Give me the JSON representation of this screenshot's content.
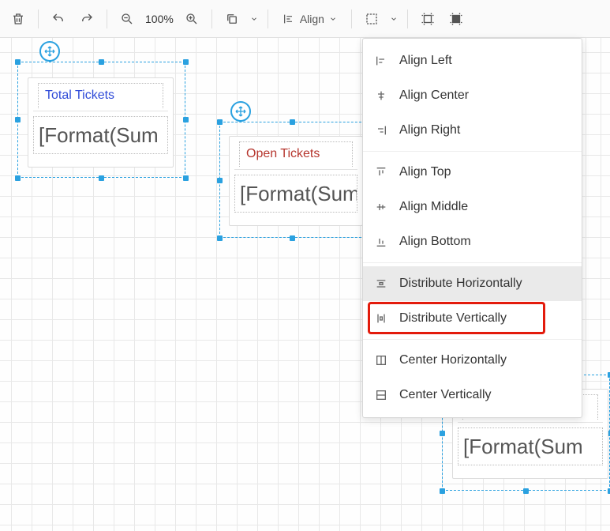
{
  "toolbar": {
    "zoom_label": "100%",
    "align_label": "Align"
  },
  "cards": {
    "c1": {
      "title": "Total Tickets",
      "body": "[Format(Sum"
    },
    "c2": {
      "title": "Open Tickets",
      "body": "[Format(Sum"
    },
    "c3": {
      "title": "",
      "body": "[Format(Sum"
    }
  },
  "menu": {
    "align_left": "Align Left",
    "align_center": "Align Center",
    "align_right": "Align Right",
    "align_top": "Align Top",
    "align_middle": "Align Middle",
    "align_bottom": "Align Bottom",
    "dist_h": "Distribute Horizontally",
    "dist_v": "Distribute Vertically",
    "center_h": "Center Horizontally",
    "center_v": "Center Vertically"
  },
  "highlight_target": "dist_v"
}
